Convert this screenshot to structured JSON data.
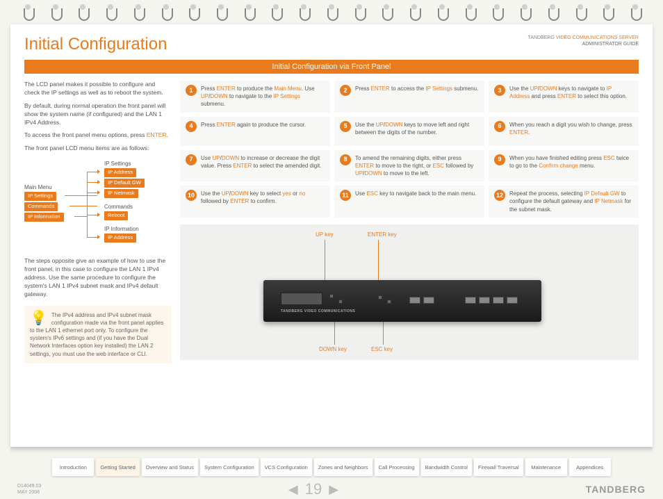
{
  "header": {
    "title": "Initial Configuration",
    "brand_line1_a": "TANDBERG ",
    "brand_line1_b": "VIDEO COMMUNICATIONS SERVER",
    "brand_line2": "ADMINISTRATOR GUIDE"
  },
  "subtitle": "Initial Configuration via Front Panel",
  "intro": {
    "p1": "The LCD panel makes it possible to configure and check the IP settings as well as to reboot the system.",
    "p2": "By default, during normal operation the front panel will show the system name (if configured) and the LAN 1 IPv4 Address.",
    "p3a": "To access the front panel menu options, press ",
    "p3b": "ENTER",
    "p3c": ".",
    "p4": "The front panel LCD menu items are as follows:",
    "p5": "The steps opposite give an example of how to use the front panel, in this case to configure the LAN 1 IPv4 address.  Use the same procedure to configure the system's LAN 1 IPv4 subnet mask and IPv4 default gateway."
  },
  "tree": {
    "main_menu": "Main Menu",
    "ip_settings": "IP Settings",
    "commands": "Commands",
    "ip_information": "IP Information",
    "ip_settings_head": "IP Settings",
    "ip_address": "IP Address",
    "ip_default_gw": "IP Default GW",
    "ip_netmask": "IP Netmask",
    "commands_head": "Commands",
    "reboot": "Reboot",
    "ip_info_head": "IP Information",
    "ip_address2": "IP Address"
  },
  "tip": "The IPv4 address and IPv4 subnet mask configuration made via the front panel applies to the LAN 1 ethernet port only. To configure the system's IPv6 settings and (if you have the Dual Network Interfaces option key installed) the LAN 2 settings, you must use the web interface or CLI.",
  "steps": [
    {
      "n": "1",
      "parts": [
        "Press ",
        "ENTER",
        " to produce the ",
        "Main Menu",
        ". Use ",
        "UP",
        "/",
        "DOWN",
        " to navigate to the ",
        "IP Settings",
        " submenu."
      ]
    },
    {
      "n": "2",
      "parts": [
        "Press ",
        "ENTER",
        " to access the ",
        "IP Settings",
        " submenu."
      ]
    },
    {
      "n": "3",
      "parts": [
        "Use the ",
        "UP",
        "/",
        "DOWN",
        " keys to navigate to ",
        "IP Address",
        " and press ",
        "ENTER",
        " to select this option."
      ]
    },
    {
      "n": "4",
      "parts": [
        "Press ",
        "ENTER",
        " again to produce the cursor."
      ]
    },
    {
      "n": "5",
      "parts": [
        "Use the ",
        "UP",
        "/",
        "DOWN",
        " keys to move left and right between the digits of the number."
      ]
    },
    {
      "n": "6",
      "parts": [
        "When you reach a digit you wish to change, press ",
        "ENTER",
        "."
      ]
    },
    {
      "n": "7",
      "parts": [
        "Use ",
        "UP",
        "/",
        "DOWN",
        " to increase or decrease the digit value.  Press ",
        "ENTER",
        " to select the amended digit."
      ]
    },
    {
      "n": "8",
      "parts": [
        "To amend the remaining digits, either press ",
        "ENTER",
        " to move to the right, or ",
        "ESC",
        " followed by ",
        "UP",
        "/",
        "DOWN",
        " to move to the left."
      ]
    },
    {
      "n": "9",
      "parts": [
        "When you have finished editing press ",
        "ESC",
        " twice to go to the ",
        "Confirm change",
        " menu."
      ]
    },
    {
      "n": "10",
      "parts": [
        "Use the ",
        "UP",
        "/",
        "DOWN",
        " key to select ",
        "yes",
        " or ",
        "no",
        " followed by ",
        "ENTER",
        " to confirm."
      ]
    },
    {
      "n": "11",
      "parts": [
        "Use ",
        "ESC",
        " key to navigate back to the main menu."
      ]
    },
    {
      "n": "12",
      "parts": [
        "Repeat the process, selecting ",
        "IP Default GW",
        " to configure the default gateway and ",
        "IP Netmask",
        " for the subnet mask."
      ]
    }
  ],
  "device_labels": {
    "up": "UP key",
    "enter": "ENTER key",
    "down": "DOWN key",
    "esc": "ESC key",
    "logo": "TANDBERG   VIDEO COMMUNICATIONS"
  },
  "tabs": [
    "Introduction",
    "Getting Started",
    "Overview and Status",
    "System Configuration",
    "VCS Configuration",
    "Zones and Neighbors",
    "Call Processing",
    "Bandwidth Control",
    "Firewall Traversal",
    "Maintenance",
    "Appendices"
  ],
  "footer": {
    "doc_id": "D14049.03",
    "date": "MAY 2008",
    "page": "19",
    "brand": "TANDBERG"
  }
}
